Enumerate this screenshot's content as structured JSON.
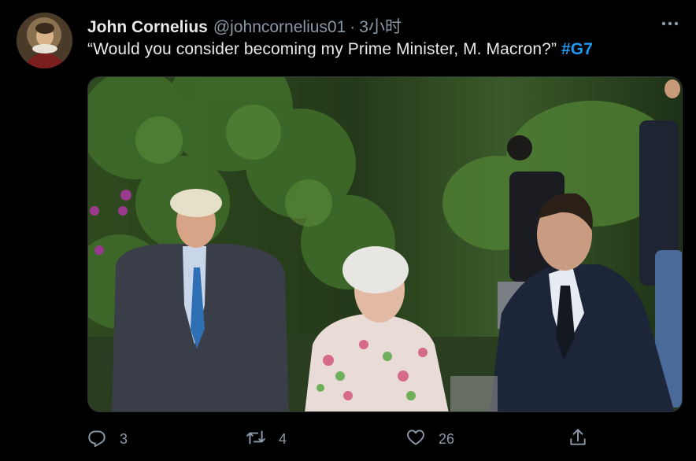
{
  "tweet": {
    "display_name": "John Cornelius",
    "handle": "@johncornelius01",
    "separator": "·",
    "time": "3小时",
    "text": "“Would you consider becoming my Prime Minister, M. Macron?”",
    "hashtag": "#G7"
  },
  "actions": {
    "reply_count": "3",
    "retweet_count": "4",
    "like_count": "26"
  },
  "colors": {
    "background": "#000000",
    "hashtag": "#1d9bf0",
    "muted": "#8b98a5"
  },
  "icons": [
    "more-icon",
    "reply-icon",
    "retweet-icon",
    "like-icon",
    "share-icon"
  ]
}
